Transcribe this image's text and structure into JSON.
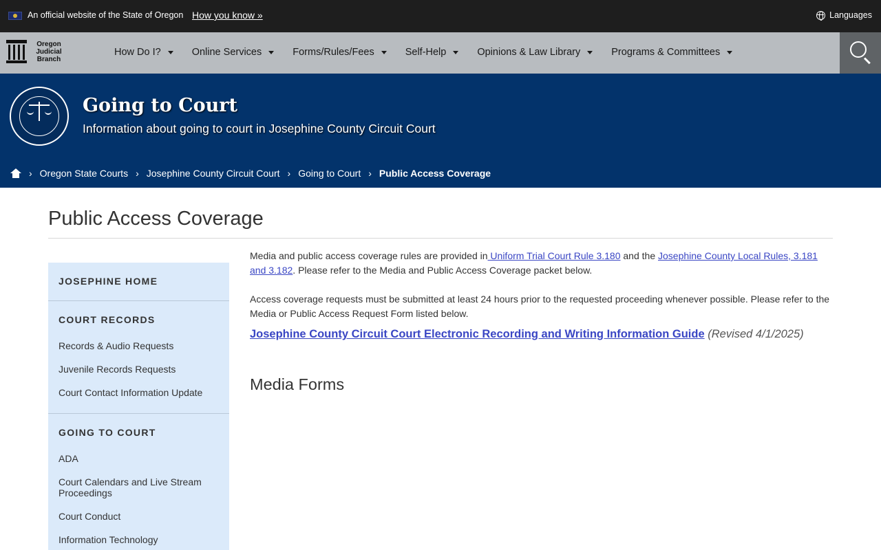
{
  "official_banner": {
    "text": "An official website of the State of Oregon",
    "how_you_know": "How you know »",
    "languages": "Languages"
  },
  "logo": {
    "line1": "Oregon",
    "line2": "Judicial",
    "line3": "Branch"
  },
  "nav": {
    "items": [
      {
        "label": "How Do I?"
      },
      {
        "label": "Online Services"
      },
      {
        "label": "Forms/Rules/Fees"
      },
      {
        "label": "Self-Help"
      },
      {
        "label": "Opinions & Law Library"
      },
      {
        "label": "Programs & Committees"
      }
    ]
  },
  "hero": {
    "title": "Going to Court",
    "subtitle": "Information about going to court in Josephine County Circuit Court"
  },
  "breadcrumb": {
    "items": [
      {
        "label": "Oregon State Courts"
      },
      {
        "label": "Josephine County Circuit Court"
      },
      {
        "label": "Going to Court"
      }
    ],
    "current": "Public Access Coverage"
  },
  "page": {
    "title": "Public Access Coverage"
  },
  "sidebar": {
    "home": "JOSEPHINE HOME",
    "court_records": {
      "heading": "COURT RECORDS",
      "links": [
        {
          "label": "Records & Audio Requests"
        },
        {
          "label": "Juvenile Records Requests"
        },
        {
          "label": "Court Contact Information Update"
        }
      ]
    },
    "going_to_court": {
      "heading": "GOING TO COURT",
      "links": [
        {
          "label": "ADA"
        },
        {
          "label": "Court Calendars and Live Stream Proceedings"
        },
        {
          "label": "Court Conduct"
        },
        {
          "label": "Information Technology"
        }
      ]
    }
  },
  "content": {
    "p1_before": "Media and public access coverage rules are provided in",
    "p1_link1": " Uniform Trial Court Rule 3.180",
    "p1_middle": " and the ",
    "p1_link2": "Josephine County Local Rules, 3.181 and 3.182",
    "p1_after": ". Please refer to the Media and Public Access Coverage packet below.",
    "p2": "Access coverage requests must be submitted at least 24 hours prior to the requested proceeding whenever possible. Please refer to the Media or Public Access Request Form listed below.",
    "guide_link": "Josephine County Circuit Court Electronic Recording and Writing Information Guide",
    "guide_revised": " (Revised 4/1/2025)",
    "media_forms_heading": "Media Forms"
  },
  "colors": {
    "banner_bg": "#1e1e1e",
    "nav_bg": "#b8bcc0",
    "hero_bg": "#03336b",
    "sidebar_bg": "#dbeafa",
    "link": "#3a46c4"
  }
}
